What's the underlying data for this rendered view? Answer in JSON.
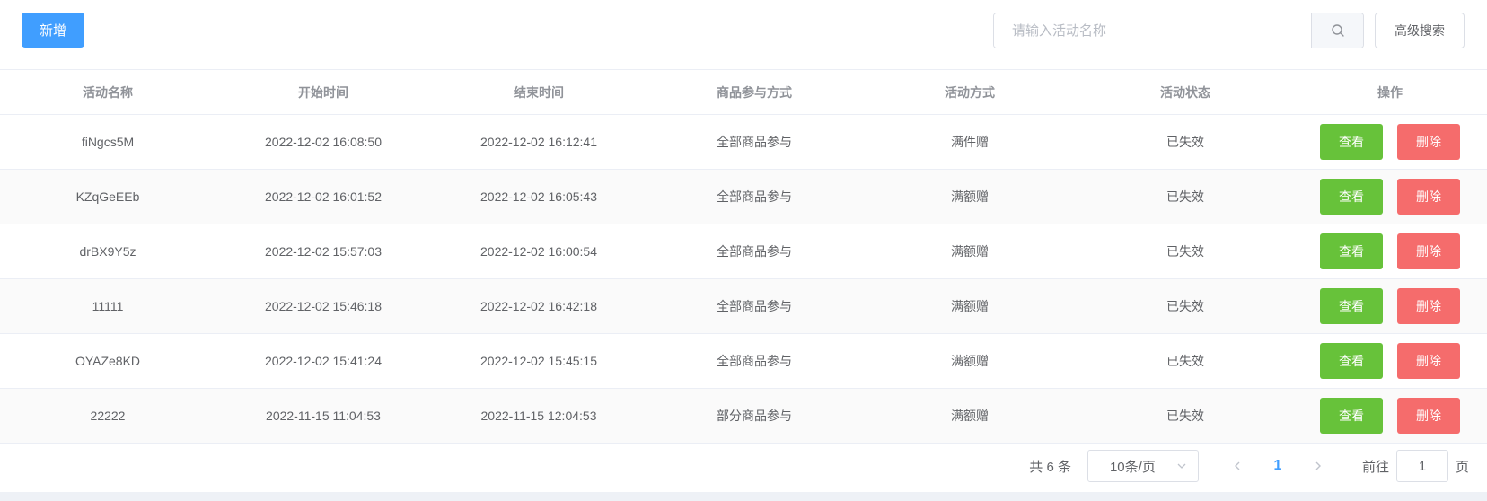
{
  "toolbar": {
    "add_label": "新增",
    "search_placeholder": "请输入活动名称",
    "search_value": "",
    "advanced_label": "高级搜索",
    "search_icon": "search-icon"
  },
  "table": {
    "headers": [
      "活动名称",
      "开始时间",
      "结束时间",
      "商品参与方式",
      "活动方式",
      "活动状态",
      "操作"
    ],
    "rows": [
      {
        "name": "fiNgcs5M",
        "start": "2022-12-02 16:08:50",
        "end": "2022-12-02 16:12:41",
        "scope": "全部商品参与",
        "mode": "满件赠",
        "status": "已失效",
        "view": "查看",
        "delete": "删除"
      },
      {
        "name": "KZqGeEEb",
        "start": "2022-12-02 16:01:52",
        "end": "2022-12-02 16:05:43",
        "scope": "全部商品参与",
        "mode": "满额赠",
        "status": "已失效",
        "view": "查看",
        "delete": "删除"
      },
      {
        "name": "drBX9Y5z",
        "start": "2022-12-02 15:57:03",
        "end": "2022-12-02 16:00:54",
        "scope": "全部商品参与",
        "mode": "满额赠",
        "status": "已失效",
        "view": "查看",
        "delete": "删除"
      },
      {
        "name": "11111",
        "start": "2022-12-02 15:46:18",
        "end": "2022-12-02 16:42:18",
        "scope": "全部商品参与",
        "mode": "满额赠",
        "status": "已失效",
        "view": "查看",
        "delete": "删除"
      },
      {
        "name": "OYAZe8KD",
        "start": "2022-12-02 15:41:24",
        "end": "2022-12-02 15:45:15",
        "scope": "全部商品参与",
        "mode": "满额赠",
        "status": "已失效",
        "view": "查看",
        "delete": "删除"
      },
      {
        "name": "22222",
        "start": "2022-11-15 11:04:53",
        "end": "2022-11-15 12:04:53",
        "scope": "部分商品参与",
        "mode": "满额赠",
        "status": "已失效",
        "view": "查看",
        "delete": "删除"
      }
    ]
  },
  "pagination": {
    "total": "共 6 条",
    "page_size": "10条/页",
    "current_page": "1",
    "goto_prefix": "前往",
    "goto_value": "1",
    "goto_suffix": "页",
    "colors": {
      "accent": "#409eff"
    }
  },
  "colors": {
    "primary": "#409eff",
    "view": "#67c23a",
    "delete": "#f56c6c"
  }
}
